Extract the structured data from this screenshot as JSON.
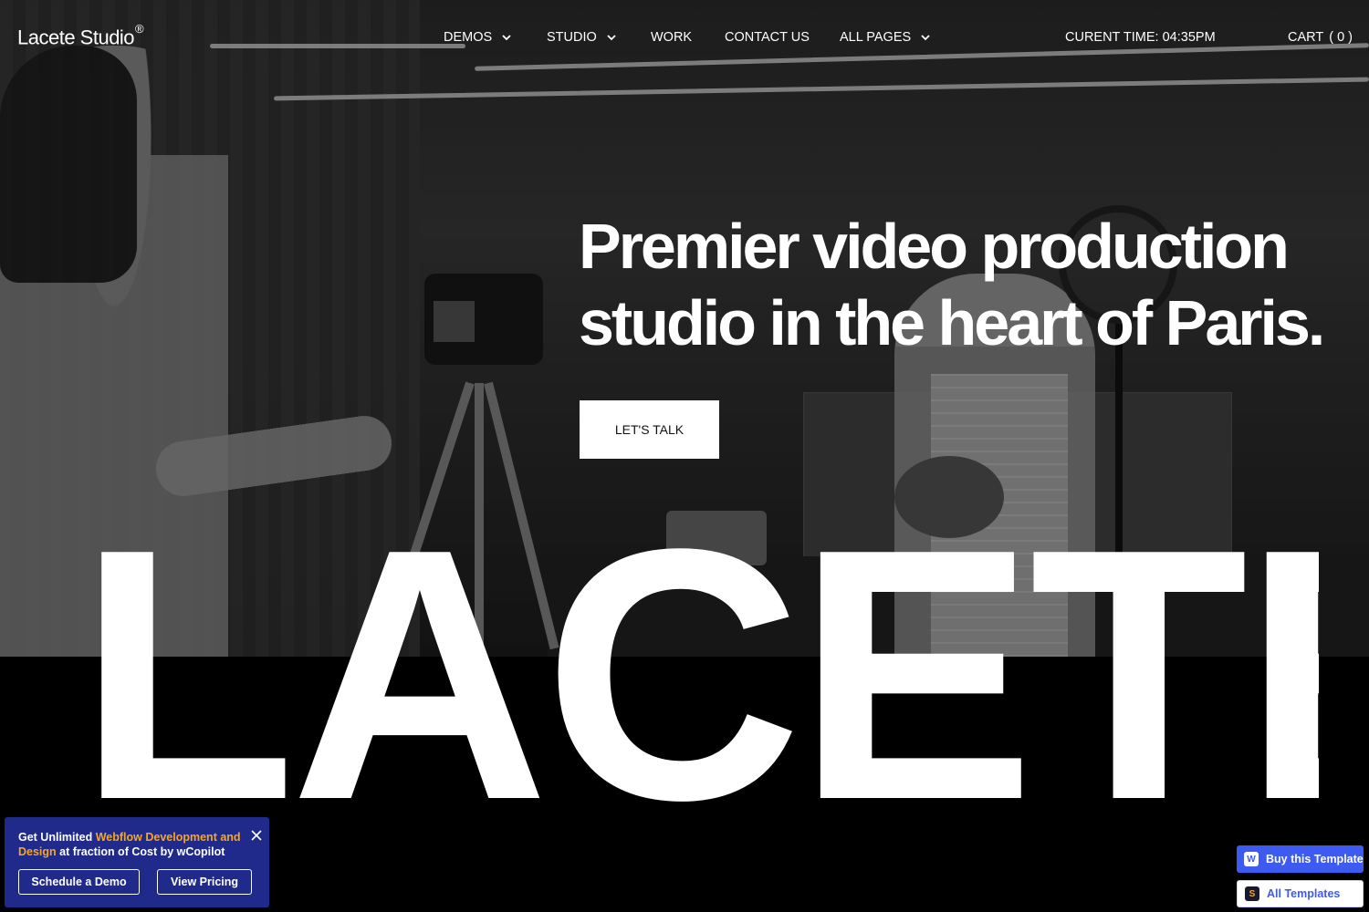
{
  "nav": {
    "logo": "Lacete Studio",
    "logo_mark": "®",
    "items": [
      {
        "label": "DEMOS",
        "has_dropdown": true
      },
      {
        "label": "STUDIO",
        "has_dropdown": true
      },
      {
        "label": "WORK",
        "has_dropdown": false
      },
      {
        "label": "CONTACT US",
        "has_dropdown": false
      },
      {
        "label": "ALL PAGES",
        "has_dropdown": true
      }
    ],
    "time_label": "CURENT TIME: 04:35PM",
    "cart_label": "CART",
    "cart_count": "( 0 )"
  },
  "hero": {
    "headline_line1": "Premier video production",
    "headline_line2": "studio in the heart of Paris.",
    "cta_label": "LET'S TALK",
    "wordmark": "LACETE"
  },
  "promo": {
    "text_prefix": "Get Unlimited ",
    "text_highlight": "Webflow Development and Design",
    "text_suffix": " at fraction of Cost by wCopilot",
    "demo_button": "Schedule a Demo",
    "pricing_button": "View Pricing",
    "close_icon": "close-icon"
  },
  "badges": {
    "buy_label": "Buy this Template",
    "all_label": "All Templates"
  },
  "colors": {
    "background": "#000000",
    "promo_bg": "#1f2a8a",
    "promo_highlight": "#f6a623",
    "badge_blue": "#3d5af1"
  }
}
